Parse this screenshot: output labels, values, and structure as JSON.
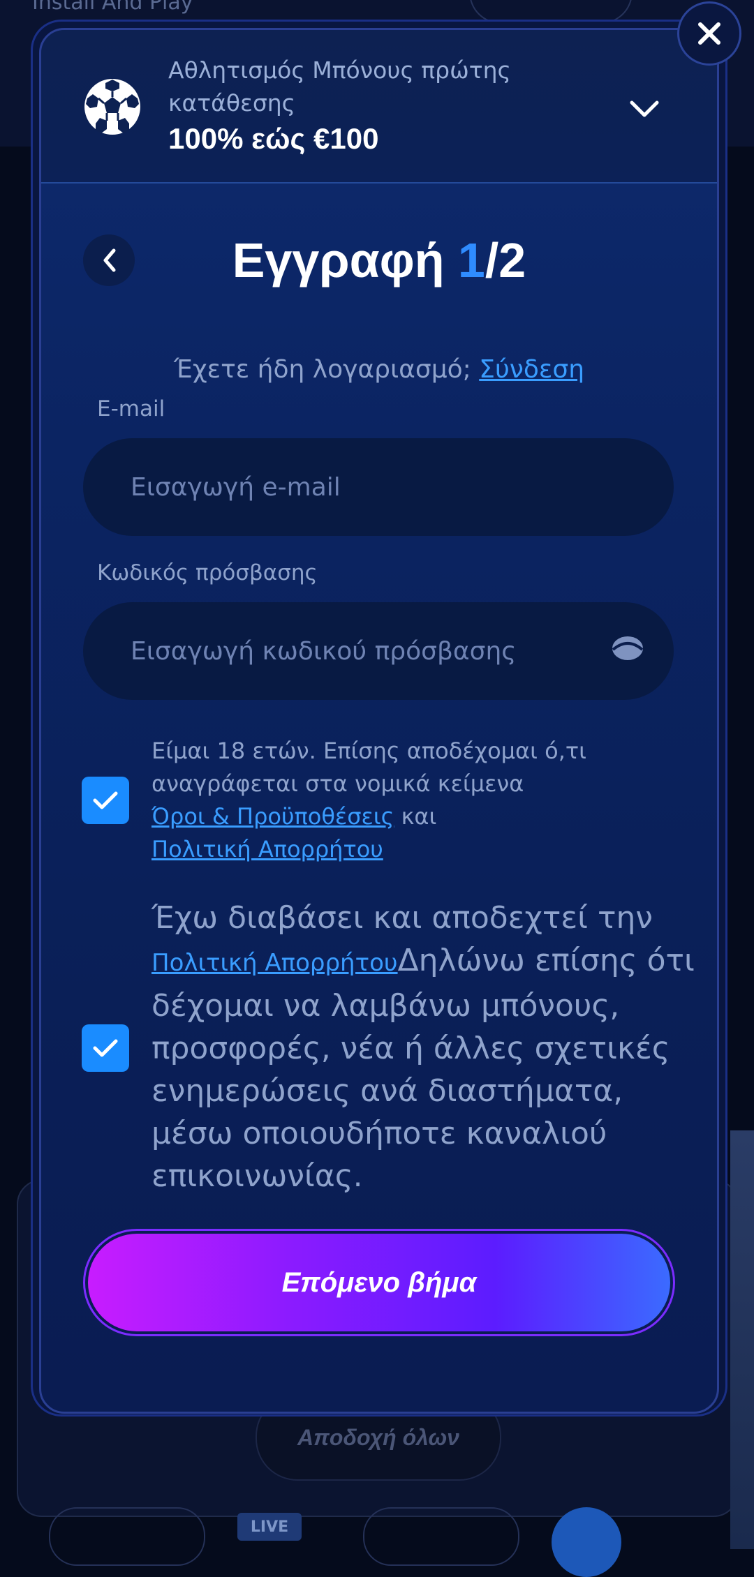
{
  "background": {
    "top_text": "Install And Play",
    "accept_all_label": "Αποδοχή όλων",
    "live_label": "LIVE"
  },
  "bonus": {
    "title": "Αθλητισμός Μπόνους πρώτης κατάθεσης",
    "amount": "100% εώς €100"
  },
  "registration": {
    "title": "Εγγραφή",
    "step_current": "1",
    "step_total": "/2",
    "have_account": "Έχετε ήδη λογαριασμό; ",
    "login_link": "Σύνδεση"
  },
  "form": {
    "email_label": "E-mail",
    "email_placeholder": "Εισαγωγή e-mail",
    "password_label": "Κωδικός πρόσβασης",
    "password_placeholder": "Εισαγωγή κωδικού πρόσβασης"
  },
  "terms": {
    "checked": true,
    "text_before": "Είμαι 18 ετών. Επίσης αποδέχομαι ό,τι αναγράφεται στα νομικά κείμενα ",
    "terms_link": "Όροι & Προϋποθέσεις",
    "and": " και ",
    "privacy_link": "Πολιτική Απορρήτου"
  },
  "consent": {
    "checked": true,
    "text_before": "Έχω διαβάσει και αποδεχτεί την ",
    "privacy_link": "Πολιτική Απορρήτου",
    "text_after": "Δηλώνω επίσης ότι δέχομαι να λαμβάνω μπόνους, προσφορές, νέα ή άλλες σχετικές ενημερώσεις ανά διαστήματα, μέσω οποιουδήποτε καναλιού επικοινωνίας."
  },
  "next_button": "Επόμενο βήμα",
  "icons": {
    "close": "close-icon",
    "ball": "soccer-ball-icon",
    "chevron": "chevron-down-icon",
    "back": "chevron-left-icon",
    "eye": "eye-icon",
    "check": "checkmark-icon"
  },
  "colors": {
    "accent": "#2f8cff",
    "checkbox": "#1a8cff",
    "button_gradient_start": "#c81cff",
    "button_gradient_end": "#3b6bff"
  }
}
